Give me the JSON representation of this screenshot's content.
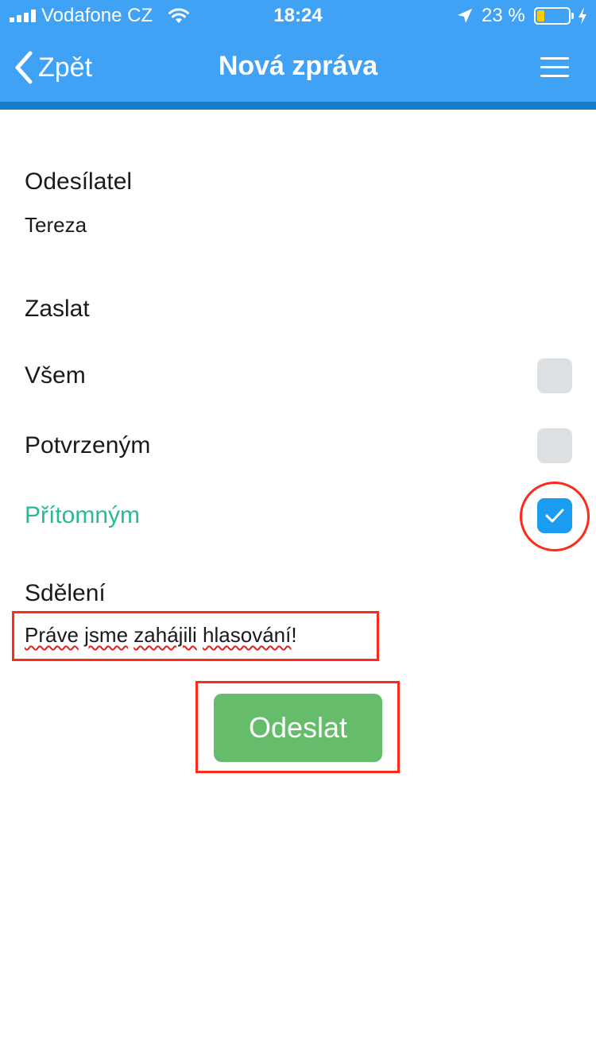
{
  "status_bar": {
    "carrier": "Vodafone CZ",
    "time": "18:24",
    "battery_percent": "23 %",
    "battery_level": 0.23,
    "icons": [
      "signal-icon",
      "wifi-icon",
      "location-arrow-icon",
      "battery-icon",
      "charging-bolt-icon"
    ]
  },
  "nav": {
    "back_label": "Zpět",
    "title": "Nová zpráva",
    "back_icon": "chevron-left-icon",
    "menu_icon": "hamburger-menu-icon"
  },
  "sender": {
    "label": "Odesílatel",
    "value": "Tereza"
  },
  "recipients": {
    "label": "Zaslat",
    "options": [
      {
        "label": "Všem",
        "checked": false
      },
      {
        "label": "Potvrzeným",
        "checked": false
      },
      {
        "label": "Přítomným",
        "checked": true
      }
    ]
  },
  "message": {
    "label": "Sdělení",
    "value_parts": [
      "Práve",
      " ",
      "jsme",
      " ",
      "zahájili",
      " ",
      "hlasování",
      "!"
    ]
  },
  "send_button": {
    "label": "Odeslat"
  },
  "colors": {
    "header": "#3fa2f4",
    "header_strip": "#137dc6",
    "active_option": "#2bb89a",
    "checkbox_checked": "#1a9cf0",
    "checkbox_unchecked": "#dde0e3",
    "send_button": "#65bc6a",
    "annotation": "#ff2a1a"
  }
}
